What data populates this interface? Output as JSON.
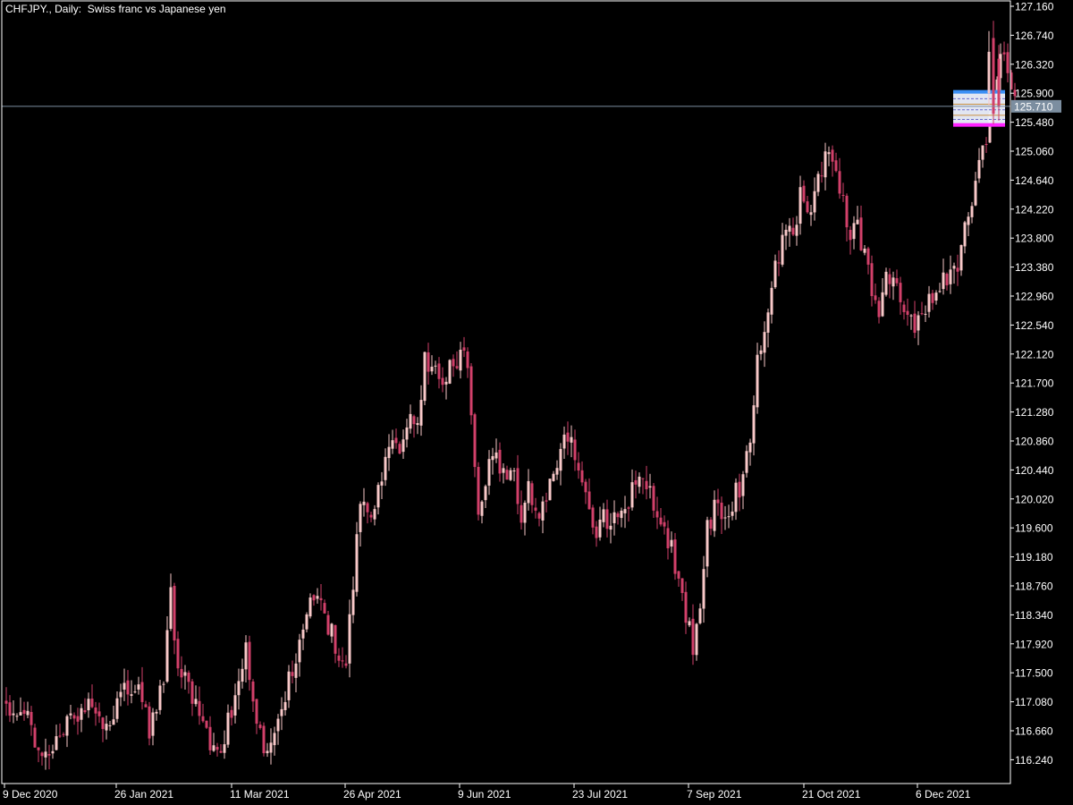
{
  "header": {
    "symbol_label": "CHFJPY., Daily:  Swiss franc vs Japanese yen"
  },
  "colors": {
    "background": "#000000",
    "foreground": "#ffffff",
    "bull_candle": "#f8c8c8",
    "bear_candle": "#d2406a",
    "price_line": "#7c8ea0",
    "price_tag_bg": "#7c8ea0",
    "zone_top": "#3b8ff5",
    "zone_fill": "#eef2ff",
    "zone_bottom": "#ff22ff",
    "zone_mid": "#c89040"
  },
  "chart_data": {
    "type": "candlestick",
    "title": "CHFJPY., Daily:  Swiss franc vs Japanese yen",
    "y_axis": {
      "range": [
        115.9,
        127.28
      ],
      "ticks": [
        "127.160",
        "126.740",
        "126.320",
        "125.900",
        "125.480",
        "125.060",
        "124.640",
        "124.220",
        "123.800",
        "123.380",
        "122.960",
        "122.540",
        "122.120",
        "121.700",
        "121.280",
        "120.860",
        "120.440",
        "120.020",
        "119.600",
        "119.180",
        "118.760",
        "118.340",
        "117.920",
        "117.500",
        "117.080",
        "116.660",
        "116.240"
      ]
    },
    "x_axis": {
      "ticks": [
        "9 Dec 2020",
        "26 Jan 2021",
        "11 Mar 2021",
        "26 Apr 2021",
        "9 Jun 2021",
        "23 Jul 2021",
        "7 Sep 2021",
        "21 Oct 2021",
        "6 Dec 2021"
      ]
    },
    "current_price": "125.710",
    "zone": {
      "top": 125.92,
      "bottom": 125.44
    },
    "path_anchors": [
      [
        0,
        117.1
      ],
      [
        6,
        116.8
      ],
      [
        10,
        116.3
      ],
      [
        14,
        116.6
      ],
      [
        18,
        116.9
      ],
      [
        23,
        117.0
      ],
      [
        27,
        116.6
      ],
      [
        31,
        117.1
      ],
      [
        36,
        117.4
      ],
      [
        40,
        116.7
      ],
      [
        44,
        117.5
      ],
      [
        46,
        118.6
      ],
      [
        48,
        117.6
      ],
      [
        52,
        117.2
      ],
      [
        56,
        116.6
      ],
      [
        60,
        116.3
      ],
      [
        64,
        117.2
      ],
      [
        67,
        117.8
      ],
      [
        70,
        116.9
      ],
      [
        73,
        116.2
      ],
      [
        76,
        116.9
      ],
      [
        80,
        117.6
      ],
      [
        84,
        118.4
      ],
      [
        87,
        118.6
      ],
      [
        90,
        118.2
      ],
      [
        93,
        117.8
      ],
      [
        95,
        117.7
      ],
      [
        97,
        118.8
      ],
      [
        99,
        119.9
      ],
      [
        102,
        119.8
      ],
      [
        105,
        120.4
      ],
      [
        108,
        120.9
      ],
      [
        110,
        120.6
      ],
      [
        113,
        121.4
      ],
      [
        115,
        121.1
      ],
      [
        117,
        122.0
      ],
      [
        120,
        121.9
      ],
      [
        122,
        121.6
      ],
      [
        125,
        122.0
      ],
      [
        128,
        122.2
      ],
      [
        129,
        121.9
      ],
      [
        132,
        119.7
      ],
      [
        134,
        120.2
      ],
      [
        136,
        120.7
      ],
      [
        139,
        120.3
      ],
      [
        141,
        120.5
      ],
      [
        144,
        119.8
      ],
      [
        146,
        120.3
      ],
      [
        149,
        119.6
      ],
      [
        152,
        120.4
      ],
      [
        155,
        120.6
      ],
      [
        157,
        121.0
      ],
      [
        159,
        120.6
      ],
      [
        161,
        120.2
      ],
      [
        163,
        119.9
      ],
      [
        165,
        119.6
      ],
      [
        167,
        119.8
      ],
      [
        169,
        119.5
      ],
      [
        171,
        119.9
      ],
      [
        174,
        120.0
      ],
      [
        176,
        120.3
      ],
      [
        179,
        120.3
      ],
      [
        181,
        119.9
      ],
      [
        184,
        119.6
      ],
      [
        186,
        119.3
      ],
      [
        188,
        118.8
      ],
      [
        190,
        118.4
      ],
      [
        192,
        117.9
      ],
      [
        194,
        118.5
      ],
      [
        196,
        119.6
      ],
      [
        198,
        119.9
      ],
      [
        200,
        119.7
      ],
      [
        202,
        119.6
      ],
      [
        204,
        120.1
      ],
      [
        206,
        120.3
      ],
      [
        208,
        121.0
      ],
      [
        210,
        122.1
      ],
      [
        212,
        122.4
      ],
      [
        214,
        123.2
      ],
      [
        216,
        123.6
      ],
      [
        218,
        124.0
      ],
      [
        220,
        123.8
      ],
      [
        222,
        124.4
      ],
      [
        224,
        124.0
      ],
      [
        226,
        124.5
      ],
      [
        228,
        124.8
      ],
      [
        230,
        125.1
      ],
      [
        232,
        124.6
      ],
      [
        234,
        124.4
      ],
      [
        236,
        123.8
      ],
      [
        238,
        123.9
      ],
      [
        240,
        123.5
      ],
      [
        242,
        123.1
      ],
      [
        244,
        122.8
      ],
      [
        246,
        123.3
      ],
      [
        248,
        123.3
      ],
      [
        250,
        123.0
      ],
      [
        252,
        122.8
      ],
      [
        254,
        122.6
      ],
      [
        256,
        122.6
      ],
      [
        258,
        122.9
      ],
      [
        260,
        123.0
      ],
      [
        262,
        123.2
      ],
      [
        264,
        123.3
      ],
      [
        266,
        123.4
      ],
      [
        268,
        124.0
      ],
      [
        270,
        124.2
      ],
      [
        272,
        124.8
      ],
      [
        274,
        125.3
      ],
      [
        276,
        125.8
      ],
      [
        278,
        126.5
      ],
      [
        280,
        126.2
      ],
      [
        282,
        125.7
      ]
    ]
  }
}
